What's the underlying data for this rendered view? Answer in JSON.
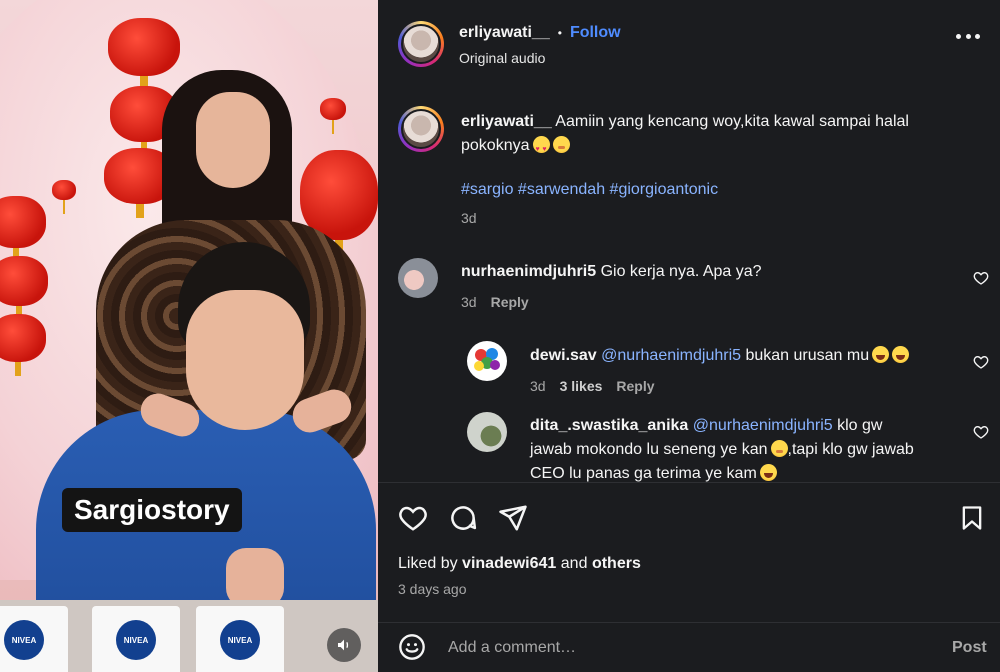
{
  "media": {
    "caption": "Sargiostory",
    "cup_brand": "NIVEA"
  },
  "header": {
    "username": "erliyawati__",
    "separator": "•",
    "follow_label": "Follow",
    "subtitle": "Original audio"
  },
  "post": {
    "username": "erliyawati__",
    "caption_line1": "Aamiin yang kencang woy,kita kawal sampai halal",
    "caption_line2": "pokoknya",
    "hashtags": "#sargio #sarwendah #giorgioantonic",
    "age": "3d"
  },
  "comments": [
    {
      "username": "nurhaenimdjuhri5",
      "text": "Gio kerja nya. Apa ya?",
      "age": "3d",
      "reply_label": "Reply"
    }
  ],
  "replies": [
    {
      "username": "dewi.sav",
      "mention": "@nurhaenimdjuhri5",
      "text": "bukan urusan mu",
      "age": "3d",
      "likes": "3 likes",
      "reply_label": "Reply"
    },
    {
      "username": "dita_.swastika_anika",
      "mention": "@nurhaenimdjuhri5",
      "text_line1": "klo gw",
      "text_line2": "jawab mokondo lu seneng ye kan",
      "text_line2b": ",tapi klo gw jawab",
      "text_line3": "CEO lu panas ga terima ye kam"
    }
  ],
  "footer": {
    "liked_by_prefix": "Liked by",
    "liked_by_user": "vinadewi641",
    "liked_by_mid": "and",
    "liked_by_others": "others",
    "date": "3 days ago",
    "comment_placeholder": "Add a comment…",
    "post_label": "Post"
  },
  "colors": {
    "panel_bg": "#1b1c1f",
    "link_blue": "#4f8cff",
    "hashtag_blue": "#8ab4ff",
    "muted_text": "#a8a8a8"
  }
}
